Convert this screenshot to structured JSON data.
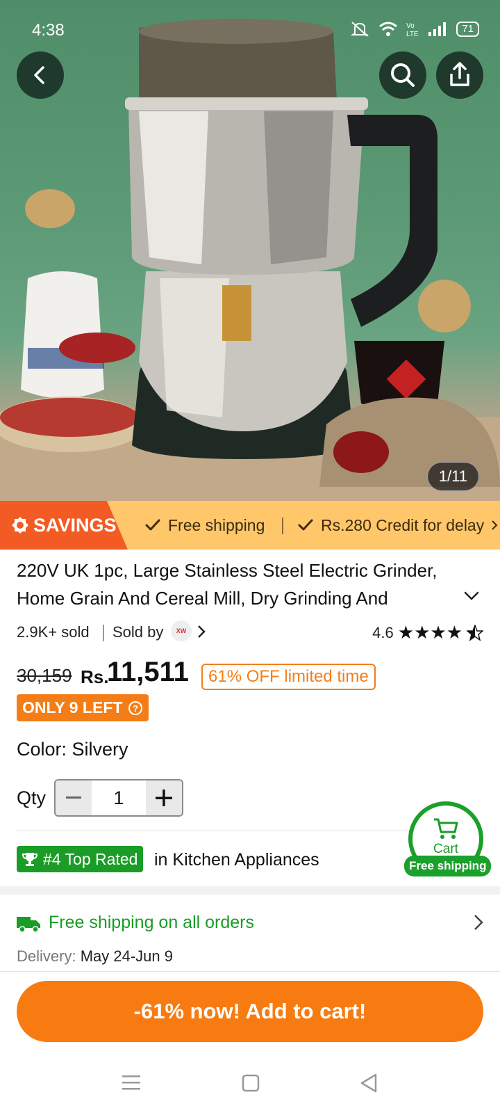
{
  "status_bar": {
    "time": "4:38",
    "battery": "71"
  },
  "hero": {
    "image_counter": "1/11"
  },
  "savings": {
    "tag": "SAVINGS",
    "benefit_1": "Free shipping",
    "benefit_2": "Rs.280 Credit for delay"
  },
  "product": {
    "title": "220V UK 1pc, Large Stainless Steel Electric Grinder, Home Grain And Cereal Mill, Dry Grinding And",
    "sold": "2.9K+ sold",
    "sold_by_label": "Sold by",
    "seller_logo_text": "XW",
    "rating": "4.6",
    "rating_value": 4.6,
    "original_price": "30,159",
    "currency": "Rs.",
    "price": "11,511",
    "discount_badge": "61% OFF limited time",
    "stock_badge": "ONLY 9 LEFT",
    "color_label": "Color: Silvery",
    "qty_label": "Qty",
    "qty_value": "1",
    "rank_badge": "#4 Top Rated",
    "rank_category": "in Kitchen Appliances"
  },
  "cart_fab": {
    "label": "Cart",
    "shipping": "Free shipping"
  },
  "shipping": {
    "title": "Free shipping on all orders",
    "delivery_label": "Delivery:",
    "delivery_value": "May 24-Jun 9"
  },
  "cta": {
    "label": "-61% now! Add to cart!"
  },
  "colors": {
    "accent_orange": "#f87b12",
    "savings_orange": "#f35b24",
    "green": "#1a9c26",
    "savings_bg": "#ffc76a"
  }
}
